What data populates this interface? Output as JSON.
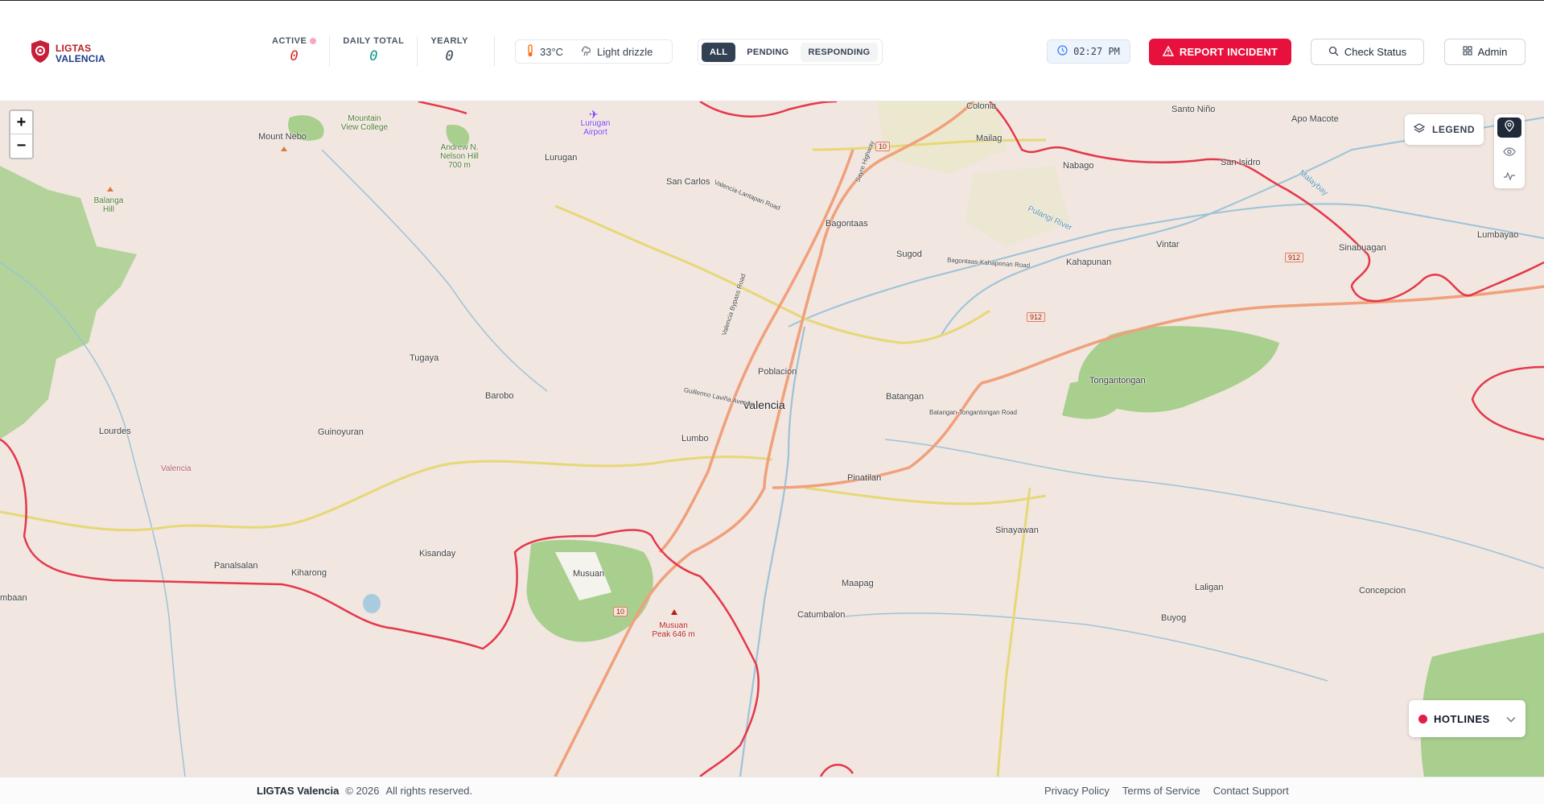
{
  "app": {
    "logo_line1": "LIGTAS",
    "logo_line2": "VALENCIA"
  },
  "stats": {
    "active_label": "ACTIVE",
    "active_value": "0",
    "daily_label": "DAILY TOTAL",
    "daily_value": "0",
    "yearly_label": "YEARLY",
    "yearly_value": "0"
  },
  "weather": {
    "temperature": "33°C",
    "condition": "Light drizzle"
  },
  "filters": {
    "all": "ALL",
    "pending": "PENDING",
    "responding": "RESPONDING",
    "selected": "ALL"
  },
  "clock": {
    "time": "02:27 PM"
  },
  "actions": {
    "report": "REPORT INCIDENT",
    "check_status": "Check Status",
    "admin": "Admin"
  },
  "map": {
    "zoom_in": "+",
    "zoom_out": "−",
    "legend_label": "LEGEND",
    "hotlines_label": "HOTLINES",
    "places": {
      "poblacion": "Poblacion",
      "valencia": "Valencia",
      "colonia": "Colonia",
      "santo_nino": "Santo Niño",
      "apo_macote": "Apo Macote",
      "mailag": "Mailag",
      "nabago": "Nabago",
      "san_isidro": "San Isidro",
      "mount_nebo": "Mount Nebo",
      "balanga_hill": "Balanga Hill",
      "mountain_view_college": "Mountain View College",
      "andrew_hill": "Andrew N. Nelson Hill 700 m",
      "lurugan_airport": "Lurugan Airport",
      "lurugan": "Lurugan",
      "san_carlos": "San Carlos",
      "bagontaas": "Bagontaas",
      "sugod": "Sugod",
      "vintar": "Vintar",
      "sinabuagan": "Sinabuagan",
      "lumbayao": "Lumbayao",
      "kahapunan": "Kahapunan",
      "tugaya": "Tugaya",
      "barobo": "Barobo",
      "lourdes": "Lourdes",
      "guinoyuran": "Guinoyuran",
      "lumbo": "Lumbo",
      "batangan": "Batangan",
      "tongantongan": "Tongantongan",
      "pinatilan": "Pinatilan",
      "laligan": "Laligan",
      "concepcion": "Concepcion",
      "sinayawan": "Sinayawan",
      "musuan_peak": "Musuan Peak 646 m",
      "kisanday": "Kisanday",
      "panalsalan": "Panalsalan",
      "kiharong": "Kiharong",
      "musuan": "Musuan",
      "maapag": "Maapag",
      "catumbalon": "Catumbalon",
      "buyog": "Buyog",
      "mbaan": "mbaan",
      "valencia_boundary": "Valencia",
      "pulangi_river": "Pulangi River",
      "malaybay": "Malaybay",
      "valencia_lantapan_road": "Valencia-Lantapan Road",
      "bagontaas_kahaponan_road": "Bagontaas-Kahaponan Road",
      "batangan_tongantongan_road": "Batangan-Tongantongan Road",
      "sayre_highway": "Sayre Highway",
      "valencia_bypass_road": "Valencia Bypass Road",
      "guillermo_lavina_avenue": "Guillermo Laviña Avenue",
      "route_10": "10",
      "route_912": "912"
    }
  },
  "footer": {
    "brand": "LIGTAS Valencia",
    "copyright": "© 2026",
    "rights": "All rights reserved.",
    "privacy": "Privacy Policy",
    "terms": "Terms of Service",
    "contact": "Contact Support"
  },
  "colors": {
    "accent_red": "#e8113d",
    "brand_blue": "#1e3a8a",
    "active_filter": "#334155"
  }
}
